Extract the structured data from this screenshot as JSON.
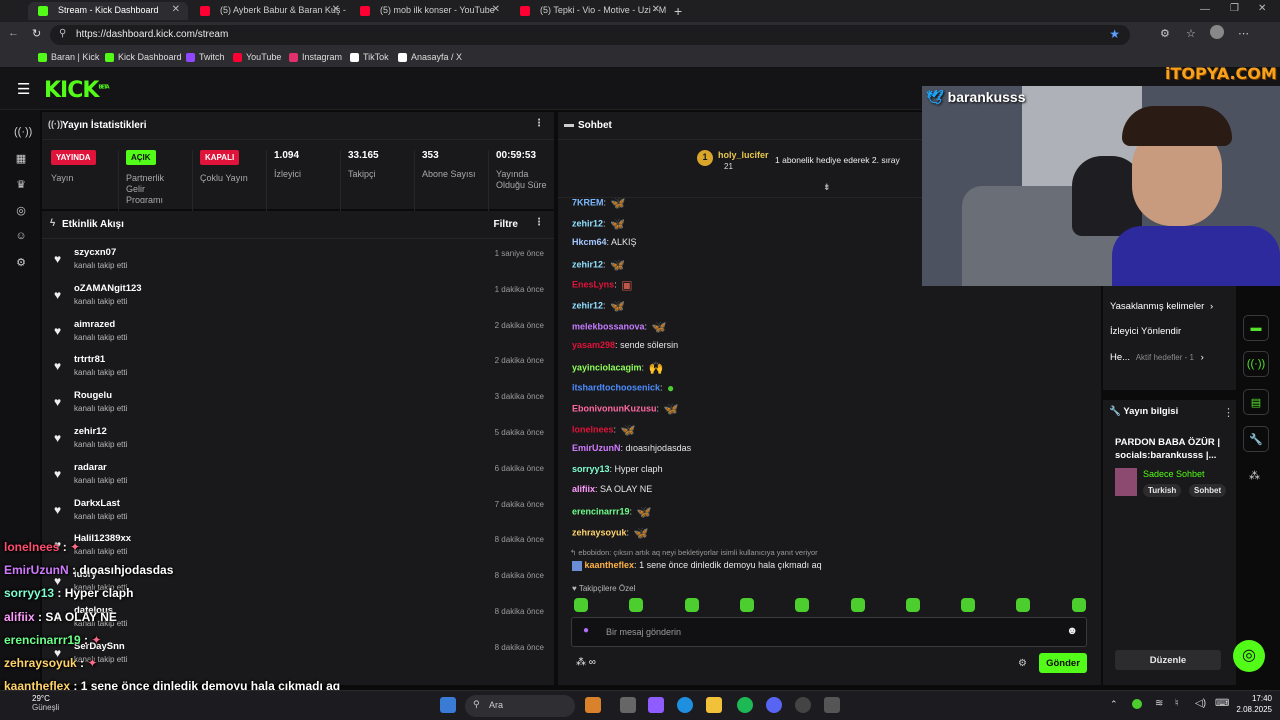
{
  "browser": {
    "tabs": [
      {
        "label": "Stream - Kick Dashboard",
        "color": "#53fc18"
      },
      {
        "label": "(5) Ayberk Babur & Baran Kuş - M",
        "color": "#ff0033"
      },
      {
        "label": "(5) mob ilk konser - YouTube",
        "color": "#ff0033"
      },
      {
        "label": "(5) Tepki - Vio - Motive - Uzi - M",
        "color": "#ff0033"
      }
    ],
    "url": "https://dashboard.kick.com/stream",
    "bookmarks": [
      {
        "label": "Baran | Kick",
        "color": "#53fc18"
      },
      {
        "label": "Kick Dashboard",
        "color": "#53fc18"
      },
      {
        "label": "Twitch",
        "color": "#9146ff"
      },
      {
        "label": "YouTube",
        "color": "#ff0033"
      },
      {
        "label": "Instagram",
        "color": "#e1306c"
      },
      {
        "label": "TikTok",
        "color": "#ffffff"
      },
      {
        "label": "Anasayfa / X",
        "color": "#ffffff"
      }
    ]
  },
  "kick": {
    "logo": "KICK",
    "logo_sup": "BETA",
    "stats_panel": {
      "title": "Yayın İstatistikleri",
      "stats": [
        {
          "badge": "YAYINDA",
          "badge_color": "#e0133a",
          "label": "Yayın"
        },
        {
          "badge": "AÇIK",
          "badge_color": "#53fc18",
          "label": "Partnerlik Gelir Programı"
        },
        {
          "badge": "KAPALI",
          "badge_color": "#e0133a",
          "label": "Çoklu Yayın"
        },
        {
          "value": "1.094",
          "label": "İzleyici"
        },
        {
          "value": "33.165",
          "label": "Takipçi"
        },
        {
          "value": "353",
          "label": "Abone Sayısı"
        },
        {
          "value": "00:59:53",
          "label": "Yayında Olduğu Süre"
        }
      ]
    },
    "activity": {
      "title": "Etkinlik Akışı",
      "filter_label": "Filtre",
      "events": [
        {
          "name": "szycxn07",
          "sub": "kanalı takip etti",
          "time": "1 saniye önce"
        },
        {
          "name": "oZAMANgit123",
          "sub": "kanalı takip etti",
          "time": "1 dakika önce"
        },
        {
          "name": "aimrazed",
          "sub": "kanalı takip etti",
          "time": "2 dakika önce"
        },
        {
          "name": "trtrtr81",
          "sub": "kanalı takip etti",
          "time": "2 dakika önce"
        },
        {
          "name": "Rougelu",
          "sub": "kanalı takip etti",
          "time": "3 dakika önce"
        },
        {
          "name": "zehir12",
          "sub": "kanalı takip etti",
          "time": "5 dakika önce"
        },
        {
          "name": "radarar",
          "sub": "kanalı takip etti",
          "time": "6 dakika önce"
        },
        {
          "name": "DarkxLast",
          "sub": "kanalı takip etti",
          "time": "7 dakika önce"
        },
        {
          "name": "Halil12389xx",
          "sub": "kanalı takip etti",
          "time": "8 dakika önce"
        },
        {
          "name": "iu3ry",
          "sub": "kanalı takip etti",
          "time": "8 dakika önce"
        },
        {
          "name": "datelous",
          "sub": "kanalı takip etti",
          "time": "8 dakika önce"
        },
        {
          "name": "SerDaySnn",
          "sub": "kanalı takip etti",
          "time": "8 dakika önce"
        }
      ]
    },
    "chat": {
      "title": "Sohbet",
      "pinned_user": "holy_lucifer",
      "pinned_count": "21",
      "pinned_badge": "1",
      "pinned_text": "1 abonelik hediye ederek 2. sıray",
      "messages": [
        {
          "user": "7KREM",
          "color": "#7ab8ff",
          "text": "",
          "emote": "butterfly"
        },
        {
          "user": "zehir12",
          "color": "#8fe0ff",
          "text": "",
          "emote": "butterfly"
        },
        {
          "user": "Hkcm64",
          "color": "#a5c8ff",
          "text": "ALKIŞ",
          "emote": ""
        },
        {
          "user": "zehir12",
          "color": "#8fe0ff",
          "text": "",
          "emote": "butterfly"
        },
        {
          "user": "EnesLyns",
          "color": "#e0133a",
          "text": "",
          "emote": "face"
        },
        {
          "user": "zehir12",
          "color": "#8fe0ff",
          "text": "",
          "emote": "butterfly"
        },
        {
          "user": "melekbossanova",
          "color": "#c47bff",
          "text": "",
          "emote": "butterfly"
        },
        {
          "user": "yasam298",
          "color": "#e0133a",
          "text": "sende sölersin",
          "emote": ""
        },
        {
          "user": "yayinciolacagim",
          "color": "#8fff5a",
          "text": "",
          "emote": "hands"
        },
        {
          "user": "itshardtochoosenick",
          "color": "#4c8cff",
          "text": "",
          "emote": "green"
        },
        {
          "user": "EbonivonunKuzusu",
          "color": "#ff6aa0",
          "text": "",
          "emote": "butterfly"
        },
        {
          "user": "lonelnees",
          "color": "#e0133a",
          "text": "",
          "emote": "butterfly"
        },
        {
          "user": "EmirUzunN",
          "color": "#d07bff",
          "text": "dıoasıhjodasdas",
          "emote": ""
        },
        {
          "user": "sorryy13",
          "color": "#7fffd0",
          "text": "Hyper claph",
          "emote": ""
        },
        {
          "user": "alifiix",
          "color": "#ff9bff",
          "text": "SA OLAY NE",
          "emote": ""
        },
        {
          "user": "erencinarrr19",
          "color": "#6cff8a",
          "text": "",
          "emote": "butterfly"
        },
        {
          "user": "zehraysoyuk",
          "color": "#ffd36b",
          "text": "",
          "emote": "butterfly"
        }
      ],
      "reply_hint": "ebobidon: çıksın artık aq neyi bekletiyorlar isimli kullanıcıya yanıt veriyor",
      "last_user": "kaantheflex",
      "last_text": "1 sene önce dinledik demoyu hala çıkmadı aq",
      "followers_only": "Takipçilere Özel",
      "input_placeholder": "Bir mesaj gönderin",
      "send_label": "Gönder"
    },
    "right": {
      "streamer": "barankusss",
      "banned_words": "Yasaklanmış kelimeler",
      "redirect": "İzleyici Yönlendir",
      "goals_short": "He...",
      "goals": "Aktif hedefler - 1",
      "stream_info_title": "Yayın bilgisi",
      "stream_title": "PARDON BABA ÖZÜR | socials:barankusss |...",
      "category": "Sadece Sohbet",
      "tags": [
        "Turkish",
        "Sohbet"
      ],
      "edit_label": "Düzenle",
      "watermark": "iTOPYA.COM"
    }
  },
  "overlay_chat": [
    {
      "user": "lonelnees",
      "color": "#ff4d6d",
      "text": ""
    },
    {
      "user": "EmirUzunN",
      "color": "#d07bff",
      "text": "dıoasıhjodasdas"
    },
    {
      "user": "sorryy13",
      "color": "#7fffd0",
      "text": "Hyper claph"
    },
    {
      "user": "alifiix",
      "color": "#ff9bff",
      "text": "SA OLAY NE"
    },
    {
      "user": "erencinarrr19",
      "color": "#6cff8a",
      "text": ""
    },
    {
      "user": "zehraysoyuk",
      "color": "#ffd36b",
      "text": ""
    },
    {
      "user": "kaantheflex",
      "color": "#ffd36b",
      "text": "1 sene önce dinledik demoyu hala çıkmadı aq"
    }
  ],
  "taskbar": {
    "weather_temp": "29°C",
    "weather_desc": "Güneşli",
    "search": "Ara",
    "time": "17:40",
    "date": "2.08.2025"
  }
}
